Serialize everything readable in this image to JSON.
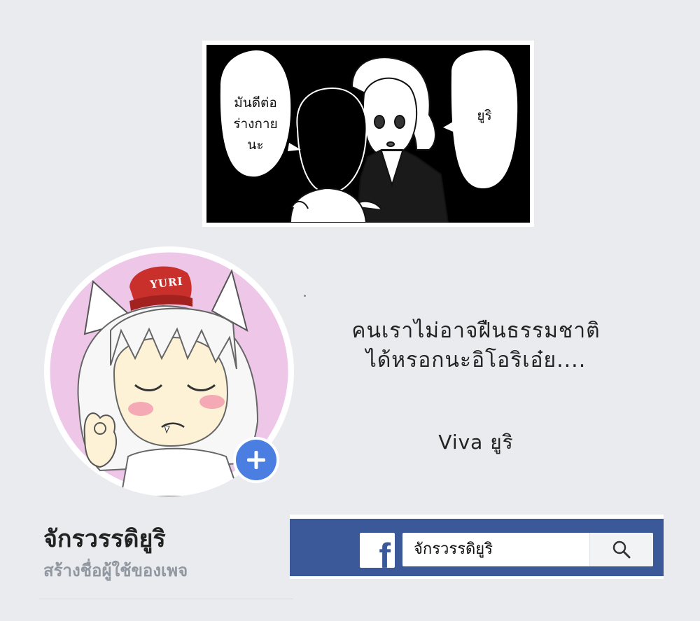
{
  "comic": {
    "bubble_left": "มันดีต่อ\nร่างกาย\nนะ",
    "bubble_right": "ยูริ"
  },
  "avatar": {
    "cap_text": "YURI"
  },
  "quote": {
    "line1": "คนเราไม่อาจฝืนธรรมชาติ",
    "line2": "ได้หรอกนะอิโอริเอ๋ย....",
    "signoff": "Viva ยูริ"
  },
  "page": {
    "name": "จักรวรรดิยูริ",
    "create_username": "สร้างชื่อผู้ใช้ของเพจ"
  },
  "search_bar": {
    "logo_letter": "f",
    "query": "จักรวรรดิยูริ",
    "search_icon": "search-icon"
  },
  "colors": {
    "background": "#e9ebee",
    "facebook_blue": "#3b5998",
    "add_button_blue": "#4a7ee0",
    "cap_red": "#c9302c",
    "avatar_bg": "#edc6e8"
  }
}
